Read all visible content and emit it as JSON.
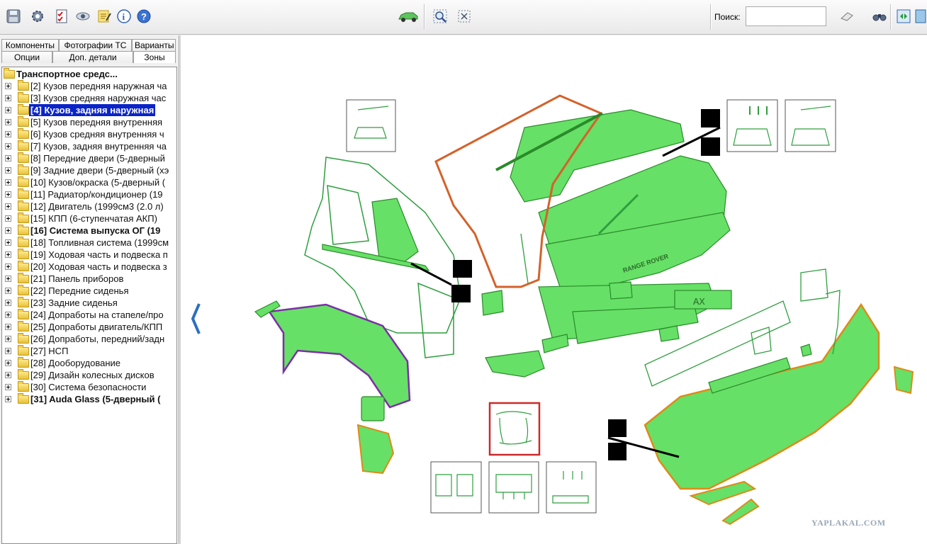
{
  "toolbar": {
    "icons": [
      "save-icon",
      "settings-icon",
      "checklist-icon",
      "eye-icon",
      "notes-icon",
      "info-icon",
      "help-icon",
      "vehicle-icon",
      "zoom-icon",
      "fit-view-icon",
      "eraser-icon",
      "binoculars-icon",
      "refresh-icon",
      "exit-icon"
    ],
    "search_label": "Поиск:",
    "search_value": ""
  },
  "tabs": {
    "row1": [
      "Компоненты",
      "Фотографии ТС",
      "Варианты"
    ],
    "row2": [
      "Опции",
      "Доп. детали",
      "Зоны"
    ]
  },
  "tree": {
    "root": "Транспортное средс...",
    "items": [
      "[2] Кузов передняя наружная ча",
      "[3] Кузов средняя наружная час",
      "[4] Кузов, задняя наружная",
      "[5] Кузов передняя внутренняя",
      "[6] Кузов средняя внутренняя ч",
      "[7] Кузов, задняя внутренняя ча",
      "[8] Передние двери (5-дверный",
      "[9] Задние двери (5-дверный (хэ",
      "[10] Кузов/окраска (5-дверный (",
      "[11] Радиатор/кондиционер (19",
      "[12] Двигатель (1999см3 (2.0 л)",
      "[15] КПП (6-ступенчатая АКП)",
      "[16] Система выпуска ОГ (19",
      "[18] Топливная система (1999см",
      "[19] Ходовая часть и подвеска п",
      "[20] Ходовая часть и подвеска з",
      "[21] Панель приборов",
      "[22] Передние сиденья",
      "[23] Задние сиденья",
      "[24] Допработы на стапеле/про",
      "[25] Допработы двигатель/КПП",
      "[26] Допработы, передний/задн",
      "[27] НСП",
      "[28] Дооборудование",
      "[29] Дизайн колесных дисков",
      "[30] Система безопасности",
      "[31] Auda Glass (5-дверный ("
    ],
    "selected_index": 2,
    "bold_indices": [
      2,
      12,
      26
    ]
  },
  "diagram": {
    "plate_text": "AX",
    "badge_text": "RANGE ROVER",
    "colors": {
      "part_fill": "#66e066",
      "part_stroke": "#2a8a2a",
      "outline": "#2f9e3f",
      "seal": "#d4622a",
      "wheel_arch": "#7b2fa6",
      "highlight_box": "#cc2a2a"
    }
  },
  "watermark": "YAPLAKAL.COM"
}
